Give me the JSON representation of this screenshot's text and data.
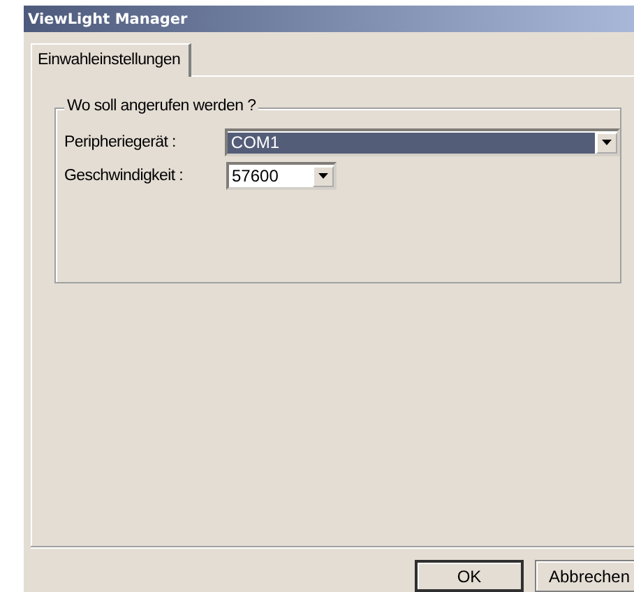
{
  "window": {
    "title": "ViewLight Manager"
  },
  "tabs": [
    {
      "label": "Einwahleinstellungen",
      "selected": true
    }
  ],
  "group": {
    "title": "Wo soll angerufen werden ?",
    "fields": [
      {
        "label": "Peripheriegerät :",
        "value": "COM1",
        "focused": true,
        "kind": "wide"
      },
      {
        "label": "Geschwindigkeit :",
        "value": "57600",
        "focused": false,
        "kind": "narrow"
      }
    ]
  },
  "buttons": [
    {
      "label": "OK",
      "default": true
    },
    {
      "label": "Abbrechen",
      "default": false
    }
  ]
}
